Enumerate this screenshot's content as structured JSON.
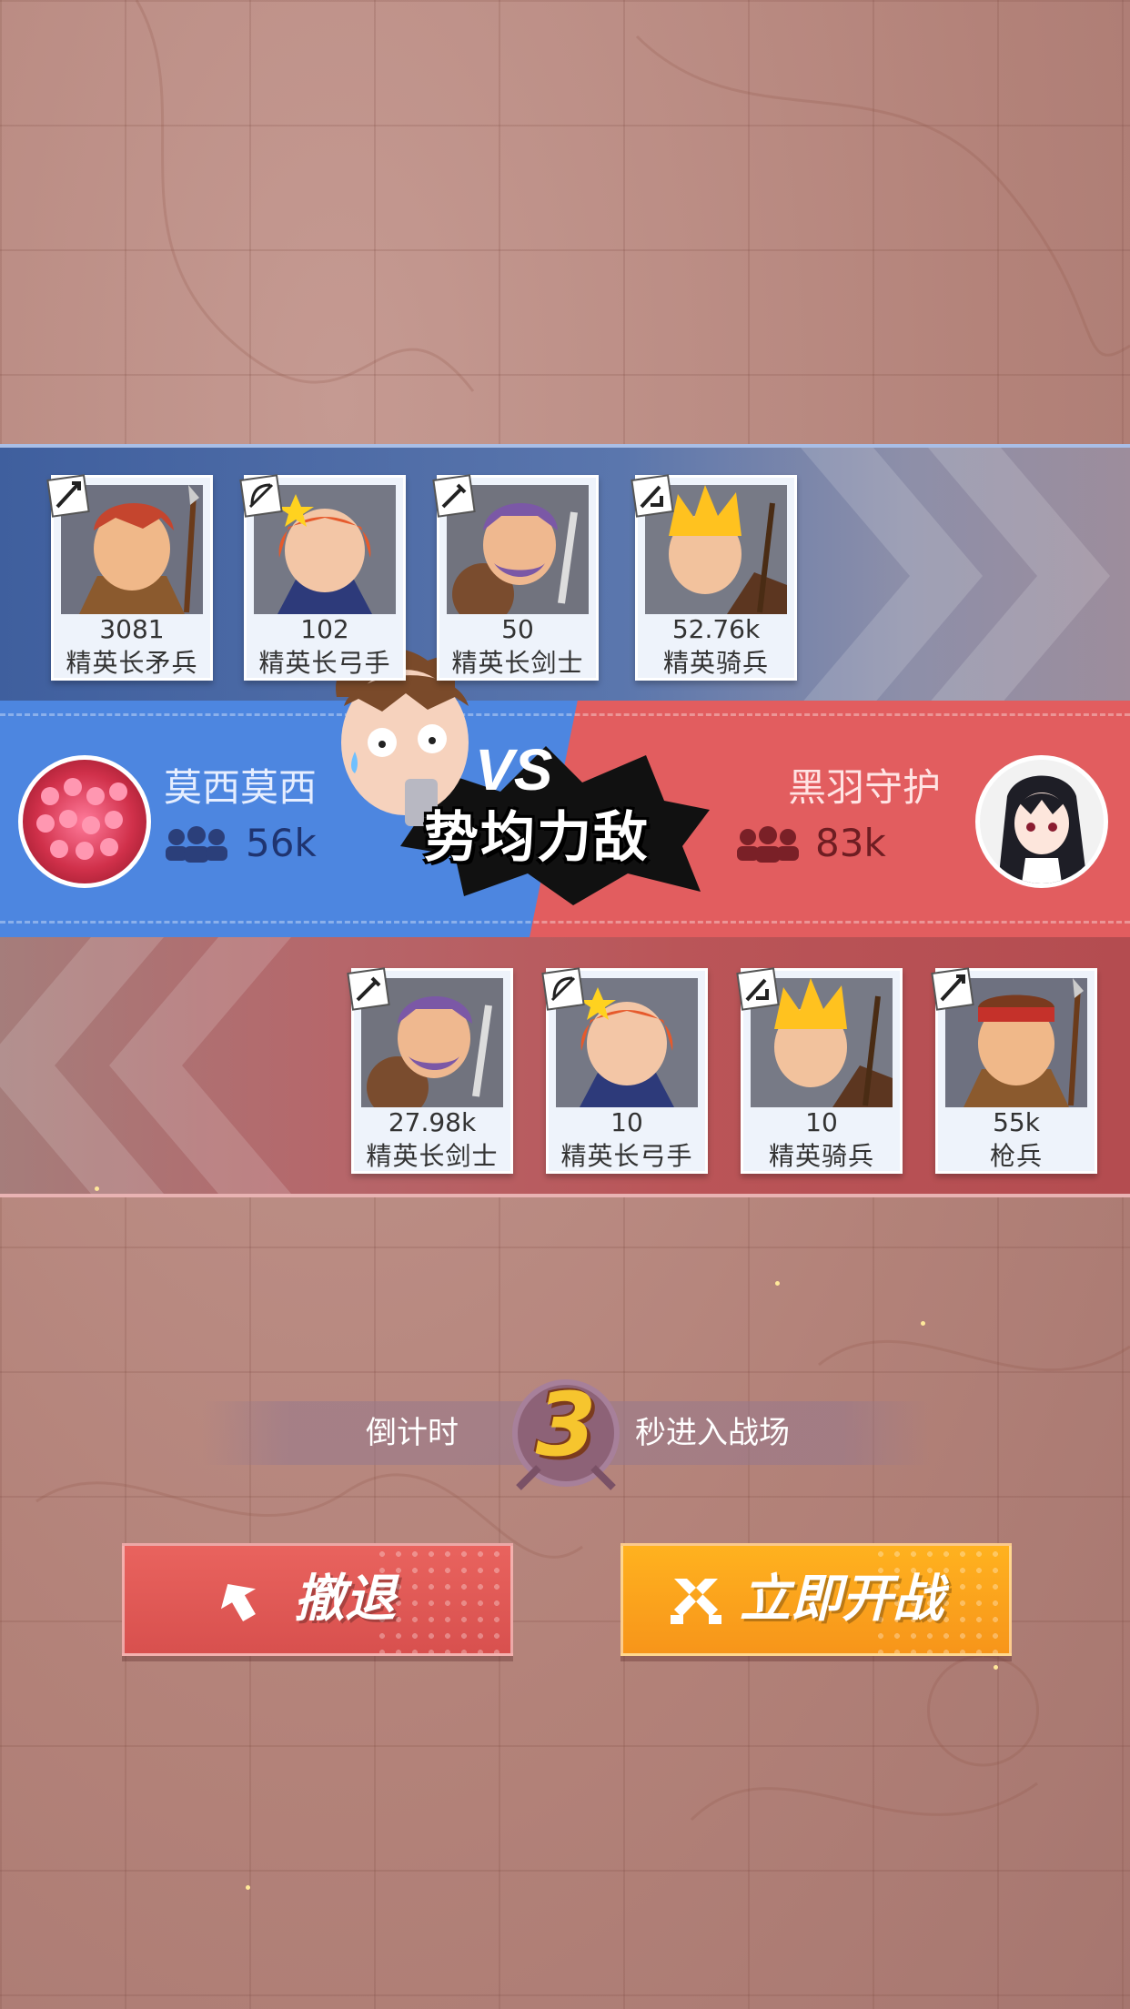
{
  "top_army": {
    "units": [
      {
        "count": "3081",
        "name": "精英长矛兵",
        "type_icon": "spear-icon"
      },
      {
        "count": "102",
        "name": "精英长弓手",
        "type_icon": "bow-icon"
      },
      {
        "count": "50",
        "name": "精英长剑士",
        "type_icon": "sword-icon"
      },
      {
        "count": "52.76k",
        "name": "精英骑兵",
        "type_icon": "cavalry-icon"
      }
    ]
  },
  "left_player": {
    "name": "莫西莫西",
    "troops": "56k",
    "icon": "people-icon"
  },
  "right_player": {
    "name": "黑羽守护",
    "troops": "83k",
    "icon": "people-icon"
  },
  "result_banner": {
    "text": "势均力敌",
    "vs": "VS"
  },
  "bottom_army": {
    "units": [
      {
        "count": "27.98k",
        "name": "精英长剑士",
        "type_icon": "sword-icon"
      },
      {
        "count": "10",
        "name": "精英长弓手",
        "type_icon": "bow-icon"
      },
      {
        "count": "10",
        "name": "精英骑兵",
        "type_icon": "cavalry-icon"
      },
      {
        "count": "55k",
        "name": "枪兵",
        "type_icon": "spear-icon"
      }
    ]
  },
  "countdown": {
    "prefix": "倒计时",
    "seconds": "3",
    "suffix": "秒进入战场"
  },
  "buttons": {
    "retreat": "撤退",
    "start": "立即开战"
  },
  "colors": {
    "blue_side": "#4d86e0",
    "red_side": "#e25d5f",
    "retreat_button": "#e25a56",
    "start_button": "#fba31d",
    "countdown_digit": "#f6c52e"
  }
}
